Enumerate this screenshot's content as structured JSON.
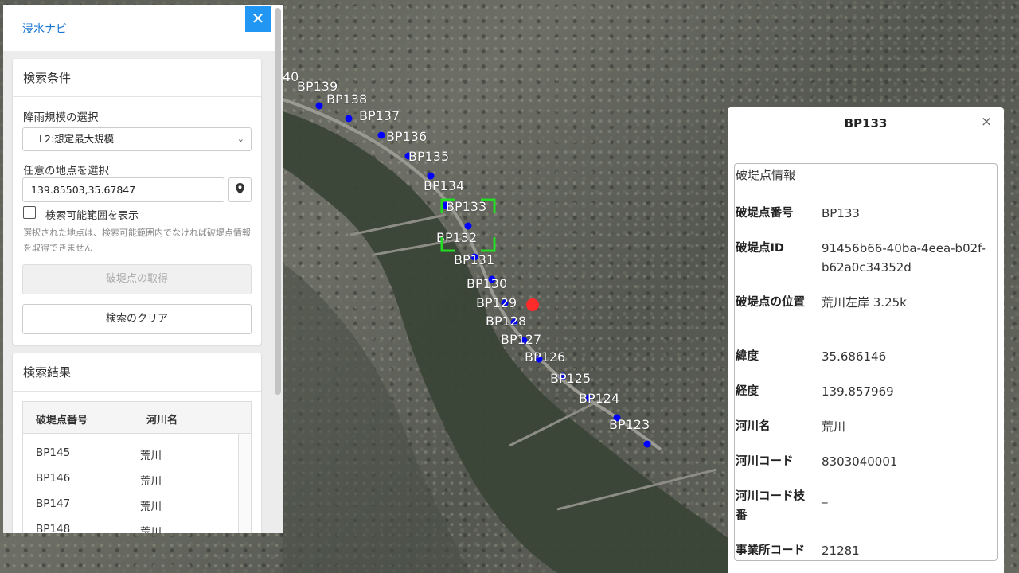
{
  "app": {
    "title": "浸水ナビ",
    "close_label": "✕"
  },
  "search": {
    "title": "検索条件",
    "rainfall_label": "降雨規模の選択",
    "rainfall_selected": "L2:想定最大規模",
    "point_label": "任意の地点を選択",
    "point_value": "139.85503,35.67847",
    "show_range_label": "検索可能範囲を表示",
    "note": "選択された地点は、検索可能範囲内でなければ破堤点情報を取得できません",
    "fetch_button": "破堤点の取得",
    "clear_button": "検索のクリア"
  },
  "results": {
    "title": "検索結果",
    "columns": [
      "破堤点番号",
      "河川名"
    ],
    "rows": [
      [
        "BP145",
        "荒川"
      ],
      [
        "BP146",
        "荒川"
      ],
      [
        "BP147",
        "荒川"
      ],
      [
        "BP148",
        "荒川"
      ]
    ]
  },
  "map": {
    "partial_label": "40",
    "points": [
      {
        "label": "BP139"
      },
      {
        "label": "BP138"
      },
      {
        "label": "BP137"
      },
      {
        "label": "BP136"
      },
      {
        "label": "BP135"
      },
      {
        "label": "BP134"
      },
      {
        "label": "BP133"
      },
      {
        "label": "BP132"
      },
      {
        "label": "BP131"
      },
      {
        "label": "BP130"
      },
      {
        "label": "BP129"
      },
      {
        "label": "BP128"
      },
      {
        "label": "BP127"
      },
      {
        "label": "BP126"
      },
      {
        "label": "BP125"
      },
      {
        "label": "BP124"
      },
      {
        "label": "BP123"
      }
    ],
    "point_color": "#0000ff",
    "marker_color": "#ff2a2a",
    "selection_color": "#22dd22"
  },
  "info": {
    "title": "BP133",
    "close_label": "×",
    "heading": "破堤点情報",
    "rows": [
      {
        "key": "破堤点番号",
        "value": "BP133"
      },
      {
        "key": "破堤点ID",
        "value": "91456b66-40ba-4eea-b02f-b62a0c34352d"
      },
      {
        "key": "破堤点の位置",
        "value": "荒川左岸 3.25k"
      },
      {
        "key": "緯度",
        "value": "35.686146"
      },
      {
        "key": "経度",
        "value": "139.857969"
      },
      {
        "key": "河川名",
        "value": "荒川"
      },
      {
        "key": "河川コード",
        "value": "8303040001"
      },
      {
        "key": "河川コード枝番",
        "value": "_"
      },
      {
        "key": "事業所コード",
        "value": "21281"
      }
    ]
  },
  "colors": {
    "accent": "#2196f3",
    "link": "#1976d2"
  }
}
